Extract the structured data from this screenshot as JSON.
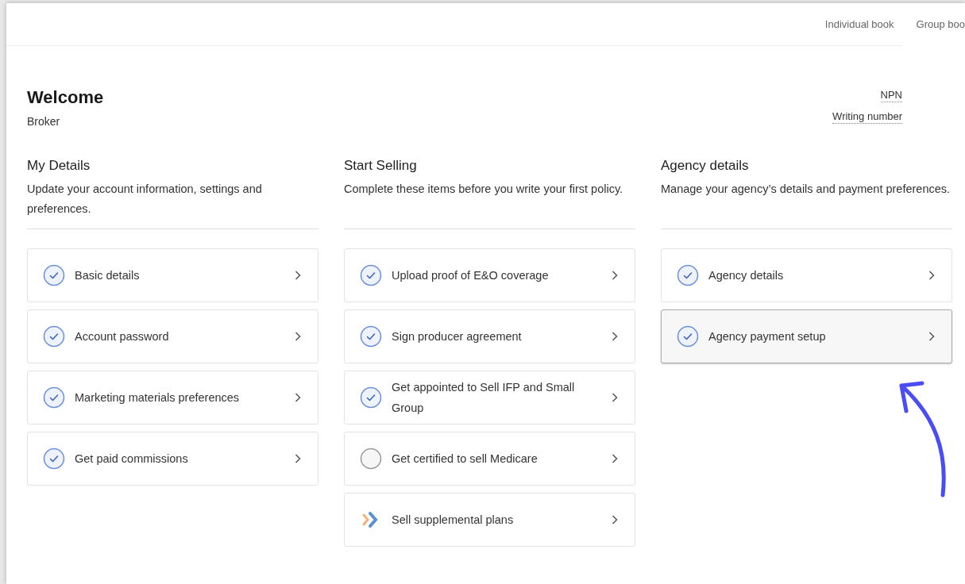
{
  "nav": {
    "links": [
      "Individual book",
      "Group boo"
    ]
  },
  "header": {
    "title": "Welcome",
    "subtitle": "Broker",
    "ids": [
      "NPN",
      "Writing number"
    ]
  },
  "sections": [
    {
      "title": "My Details",
      "description": "Update your account information, settings and preferences.",
      "items": [
        {
          "label": "Basic details",
          "kind": "done",
          "highlighted": false
        },
        {
          "label": "Account password",
          "kind": "done",
          "highlighted": false
        },
        {
          "label": "Marketing materials preferences",
          "kind": "done",
          "highlighted": false
        },
        {
          "label": "Get paid commissions",
          "kind": "done",
          "highlighted": false
        }
      ]
    },
    {
      "title": "Start Selling",
      "description": "Complete these items before you write your first policy.",
      "items": [
        {
          "label": "Upload proof of E&O coverage",
          "kind": "done",
          "highlighted": false
        },
        {
          "label": "Sign producer agreement",
          "kind": "done",
          "highlighted": false
        },
        {
          "label": "Get appointed to Sell IFP and Small Group",
          "kind": "done",
          "highlighted": false
        },
        {
          "label": "Get certified to sell Medicare",
          "kind": "todo",
          "highlighted": false
        },
        {
          "label": "Sell supplemental plans",
          "kind": "promo",
          "highlighted": false
        }
      ]
    },
    {
      "title": "Agency details",
      "description": "Manage your agency’s details and payment preferences.",
      "items": [
        {
          "label": "Agency details",
          "kind": "done",
          "highlighted": false
        },
        {
          "label": "Agency payment setup",
          "kind": "done",
          "highlighted": true
        }
      ]
    }
  ]
}
